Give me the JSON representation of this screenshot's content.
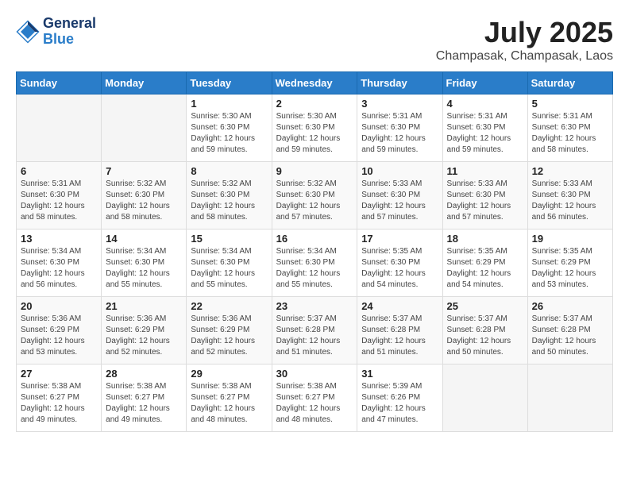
{
  "header": {
    "logo": {
      "line1": "General",
      "line2": "Blue"
    },
    "month": "July 2025",
    "location": "Champasak, Champasak, Laos"
  },
  "days_of_week": [
    "Sunday",
    "Monday",
    "Tuesday",
    "Wednesday",
    "Thursday",
    "Friday",
    "Saturday"
  ],
  "weeks": [
    [
      {
        "day": "",
        "info": ""
      },
      {
        "day": "",
        "info": ""
      },
      {
        "day": "1",
        "info": "Sunrise: 5:30 AM\nSunset: 6:30 PM\nDaylight: 12 hours and 59 minutes."
      },
      {
        "day": "2",
        "info": "Sunrise: 5:30 AM\nSunset: 6:30 PM\nDaylight: 12 hours and 59 minutes."
      },
      {
        "day": "3",
        "info": "Sunrise: 5:31 AM\nSunset: 6:30 PM\nDaylight: 12 hours and 59 minutes."
      },
      {
        "day": "4",
        "info": "Sunrise: 5:31 AM\nSunset: 6:30 PM\nDaylight: 12 hours and 59 minutes."
      },
      {
        "day": "5",
        "info": "Sunrise: 5:31 AM\nSunset: 6:30 PM\nDaylight: 12 hours and 58 minutes."
      }
    ],
    [
      {
        "day": "6",
        "info": "Sunrise: 5:31 AM\nSunset: 6:30 PM\nDaylight: 12 hours and 58 minutes."
      },
      {
        "day": "7",
        "info": "Sunrise: 5:32 AM\nSunset: 6:30 PM\nDaylight: 12 hours and 58 minutes."
      },
      {
        "day": "8",
        "info": "Sunrise: 5:32 AM\nSunset: 6:30 PM\nDaylight: 12 hours and 58 minutes."
      },
      {
        "day": "9",
        "info": "Sunrise: 5:32 AM\nSunset: 6:30 PM\nDaylight: 12 hours and 57 minutes."
      },
      {
        "day": "10",
        "info": "Sunrise: 5:33 AM\nSunset: 6:30 PM\nDaylight: 12 hours and 57 minutes."
      },
      {
        "day": "11",
        "info": "Sunrise: 5:33 AM\nSunset: 6:30 PM\nDaylight: 12 hours and 57 minutes."
      },
      {
        "day": "12",
        "info": "Sunrise: 5:33 AM\nSunset: 6:30 PM\nDaylight: 12 hours and 56 minutes."
      }
    ],
    [
      {
        "day": "13",
        "info": "Sunrise: 5:34 AM\nSunset: 6:30 PM\nDaylight: 12 hours and 56 minutes."
      },
      {
        "day": "14",
        "info": "Sunrise: 5:34 AM\nSunset: 6:30 PM\nDaylight: 12 hours and 55 minutes."
      },
      {
        "day": "15",
        "info": "Sunrise: 5:34 AM\nSunset: 6:30 PM\nDaylight: 12 hours and 55 minutes."
      },
      {
        "day": "16",
        "info": "Sunrise: 5:34 AM\nSunset: 6:30 PM\nDaylight: 12 hours and 55 minutes."
      },
      {
        "day": "17",
        "info": "Sunrise: 5:35 AM\nSunset: 6:30 PM\nDaylight: 12 hours and 54 minutes."
      },
      {
        "day": "18",
        "info": "Sunrise: 5:35 AM\nSunset: 6:29 PM\nDaylight: 12 hours and 54 minutes."
      },
      {
        "day": "19",
        "info": "Sunrise: 5:35 AM\nSunset: 6:29 PM\nDaylight: 12 hours and 53 minutes."
      }
    ],
    [
      {
        "day": "20",
        "info": "Sunrise: 5:36 AM\nSunset: 6:29 PM\nDaylight: 12 hours and 53 minutes."
      },
      {
        "day": "21",
        "info": "Sunrise: 5:36 AM\nSunset: 6:29 PM\nDaylight: 12 hours and 52 minutes."
      },
      {
        "day": "22",
        "info": "Sunrise: 5:36 AM\nSunset: 6:29 PM\nDaylight: 12 hours and 52 minutes."
      },
      {
        "day": "23",
        "info": "Sunrise: 5:37 AM\nSunset: 6:28 PM\nDaylight: 12 hours and 51 minutes."
      },
      {
        "day": "24",
        "info": "Sunrise: 5:37 AM\nSunset: 6:28 PM\nDaylight: 12 hours and 51 minutes."
      },
      {
        "day": "25",
        "info": "Sunrise: 5:37 AM\nSunset: 6:28 PM\nDaylight: 12 hours and 50 minutes."
      },
      {
        "day": "26",
        "info": "Sunrise: 5:37 AM\nSunset: 6:28 PM\nDaylight: 12 hours and 50 minutes."
      }
    ],
    [
      {
        "day": "27",
        "info": "Sunrise: 5:38 AM\nSunset: 6:27 PM\nDaylight: 12 hours and 49 minutes."
      },
      {
        "day": "28",
        "info": "Sunrise: 5:38 AM\nSunset: 6:27 PM\nDaylight: 12 hours and 49 minutes."
      },
      {
        "day": "29",
        "info": "Sunrise: 5:38 AM\nSunset: 6:27 PM\nDaylight: 12 hours and 48 minutes."
      },
      {
        "day": "30",
        "info": "Sunrise: 5:38 AM\nSunset: 6:27 PM\nDaylight: 12 hours and 48 minutes."
      },
      {
        "day": "31",
        "info": "Sunrise: 5:39 AM\nSunset: 6:26 PM\nDaylight: 12 hours and 47 minutes."
      },
      {
        "day": "",
        "info": ""
      },
      {
        "day": "",
        "info": ""
      }
    ]
  ]
}
